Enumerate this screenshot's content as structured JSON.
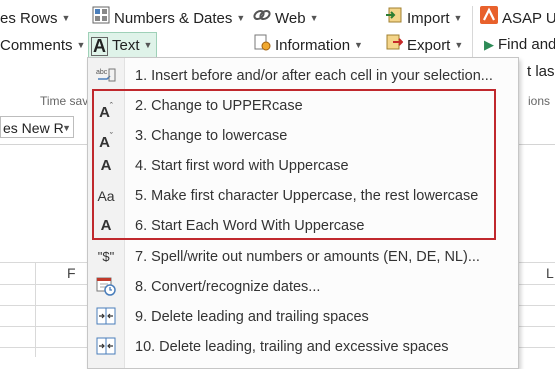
{
  "ribbon": {
    "rows_label": "es Rows",
    "numbers_dates_label": "Numbers & Dates",
    "web_label": "Web",
    "import_label": "Import",
    "asap_label": "ASAP U",
    "comments_label": "Comments",
    "text_label": "Text",
    "information_label": "Information",
    "export_label": "Export",
    "find_label": "Find and",
    "partial_label": "t las",
    "time_saver_label": "Time sav",
    "options_label": "ions",
    "font_name": "es New R"
  },
  "sheet": {
    "col_f": "F",
    "col_l": "L"
  },
  "menu": {
    "items": [
      {
        "label": "1. Insert before and/or after each cell in your selection...",
        "icon": "insert-text-icon",
        "glyph": "abc"
      },
      {
        "label": "2. Change to UPPERcase",
        "icon": "uppercase-icon",
        "glyph": "A"
      },
      {
        "label": "3. Change to lowercase",
        "icon": "lowercase-icon",
        "glyph": "A"
      },
      {
        "label": "4. Start first word with Uppercase",
        "icon": "sentence-case-icon",
        "glyph": "A"
      },
      {
        "label": "5. Make first character Uppercase, the rest lowercase",
        "icon": "capitalize-icon",
        "glyph": "Aa"
      },
      {
        "label": "6. Start Each Word With Uppercase",
        "icon": "title-case-icon",
        "glyph": "A"
      },
      {
        "label": "7. Spell/write out numbers or amounts (EN, DE, NL)...",
        "icon": "spell-number-icon",
        "glyph": "\"$\""
      },
      {
        "label": "8. Convert/recognize dates...",
        "icon": "calendar-clock-icon",
        "glyph": ""
      },
      {
        "label": "9. Delete leading and trailing spaces",
        "icon": "trim-spaces-icon",
        "glyph": ""
      },
      {
        "label": "10. Delete leading, trailing and excessive spaces",
        "icon": "trim-all-spaces-icon",
        "glyph": ""
      }
    ]
  },
  "colors": {
    "highlight_border": "#c0282d",
    "text_button_bg": "#dff3e9",
    "asap_orange": "#e8612c",
    "play_green": "#2e8b57"
  }
}
